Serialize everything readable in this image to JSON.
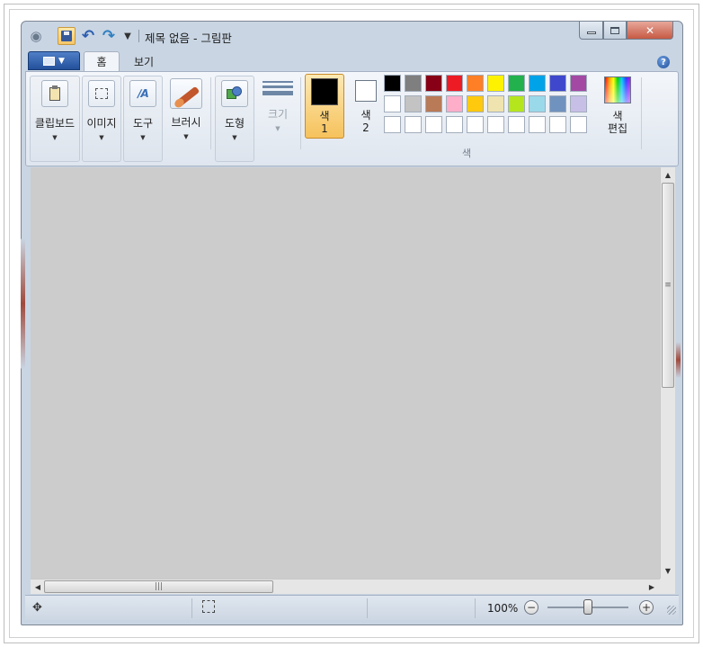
{
  "window": {
    "title": "제목 없음 - 그림판"
  },
  "tabs": {
    "home": "홈",
    "view": "보기"
  },
  "ribbon": {
    "clipboard": "클립보드",
    "image": "이미지",
    "tools": "도구",
    "brushes": "브러시",
    "shapes": "도형",
    "size": "크기",
    "color1_line1": "색",
    "color1_line2": "1",
    "color2_line1": "색",
    "color2_line2": "2",
    "colors_group": "색",
    "edit_colors_line1": "색",
    "edit_colors_line2": "편집",
    "color1_value": "#000000",
    "color2_value": "#ffffff"
  },
  "palette": {
    "row1": [
      "#000000",
      "#7f7f7f",
      "#880015",
      "#ed1c24",
      "#ff7f27",
      "#fff200",
      "#22b14c",
      "#00a2e8",
      "#3f48cc",
      "#a349a4"
    ],
    "row2": [
      "#ffffff",
      "#c3c3c3",
      "#b97a57",
      "#ffaec9",
      "#ffc90e",
      "#efe4b0",
      "#b5e61d",
      "#99d9ea",
      "#7092be",
      "#c8bfe7"
    ],
    "row3": [
      "#ffffff",
      "#ffffff",
      "#ffffff",
      "#ffffff",
      "#ffffff",
      "#ffffff",
      "#ffffff",
      "#ffffff",
      "#ffffff",
      "#ffffff"
    ]
  },
  "status": {
    "zoom": "100%",
    "zoom_out": "−",
    "zoom_in": "+"
  },
  "icons": {
    "app": "paint-app-icon",
    "save": "floppy-icon",
    "undo": "undo-icon",
    "redo": "redo-icon",
    "help": "help-icon"
  }
}
